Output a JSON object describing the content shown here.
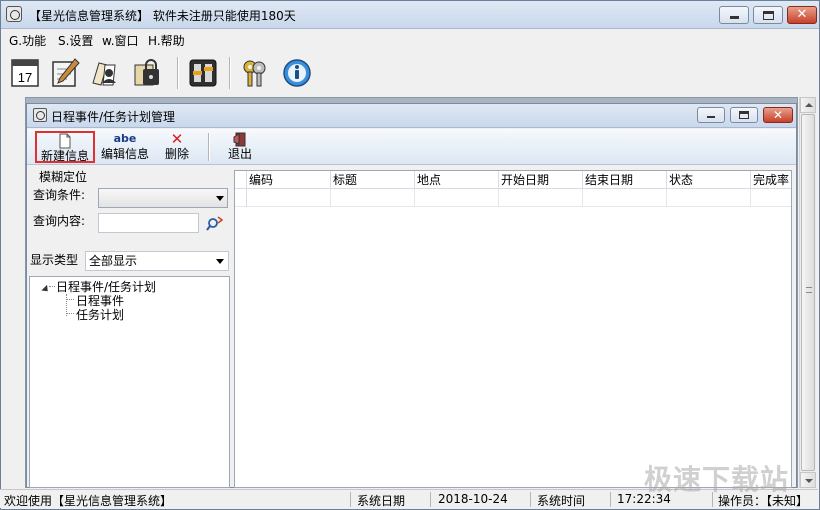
{
  "window": {
    "title": "【星光信息管理系统】 软件未注册只能使用180天",
    "close_glyph": "✕"
  },
  "menu": [
    "G.功能",
    "S.设置",
    "w.窗口",
    "H.帮助"
  ],
  "main_toolbar": {
    "icons": [
      "calendar-icon",
      "notepad-pen-icon",
      "contacts-icon",
      "lock-icon",
      "settings-icon",
      "keys-icon",
      "help-icon"
    ],
    "calendar_day": "17"
  },
  "child_window": {
    "title": "日程事件/任务计划管理",
    "close_glyph": "✕"
  },
  "child_toolbar": {
    "new_label": "新建信息",
    "edit_label": "编辑信息",
    "edit_icon_text": "abe",
    "delete_label": "删除",
    "delete_icon_text": "✕",
    "exit_label": "退出",
    "new_highlight_color": "#e03030"
  },
  "search": {
    "group_label": "模糊定位",
    "condition_label": "查询条件:",
    "condition_value": "",
    "content_label": "查询内容:",
    "content_value": "",
    "display_type_label": "显示类型",
    "display_type_value": "全部显示"
  },
  "tree": {
    "root": "日程事件/任务计划",
    "children": [
      "日程事件",
      "任务计划"
    ]
  },
  "grid": {
    "columns": [
      "编码",
      "标题",
      "地点",
      "开始日期",
      "结束日期",
      "状态",
      "完成率"
    ],
    "rows": [
      [
        "",
        "",
        "",
        "",
        "",
        "",
        ""
      ]
    ]
  },
  "status": {
    "welcome": "欢迎使用【星光信息管理系统】",
    "date_label": "系统日期",
    "date_value": "2018-10-24",
    "time_label": "系统时间",
    "time_value": "17:22:34",
    "operator": "操作员：【未知】"
  },
  "watermark": "极速下载站"
}
